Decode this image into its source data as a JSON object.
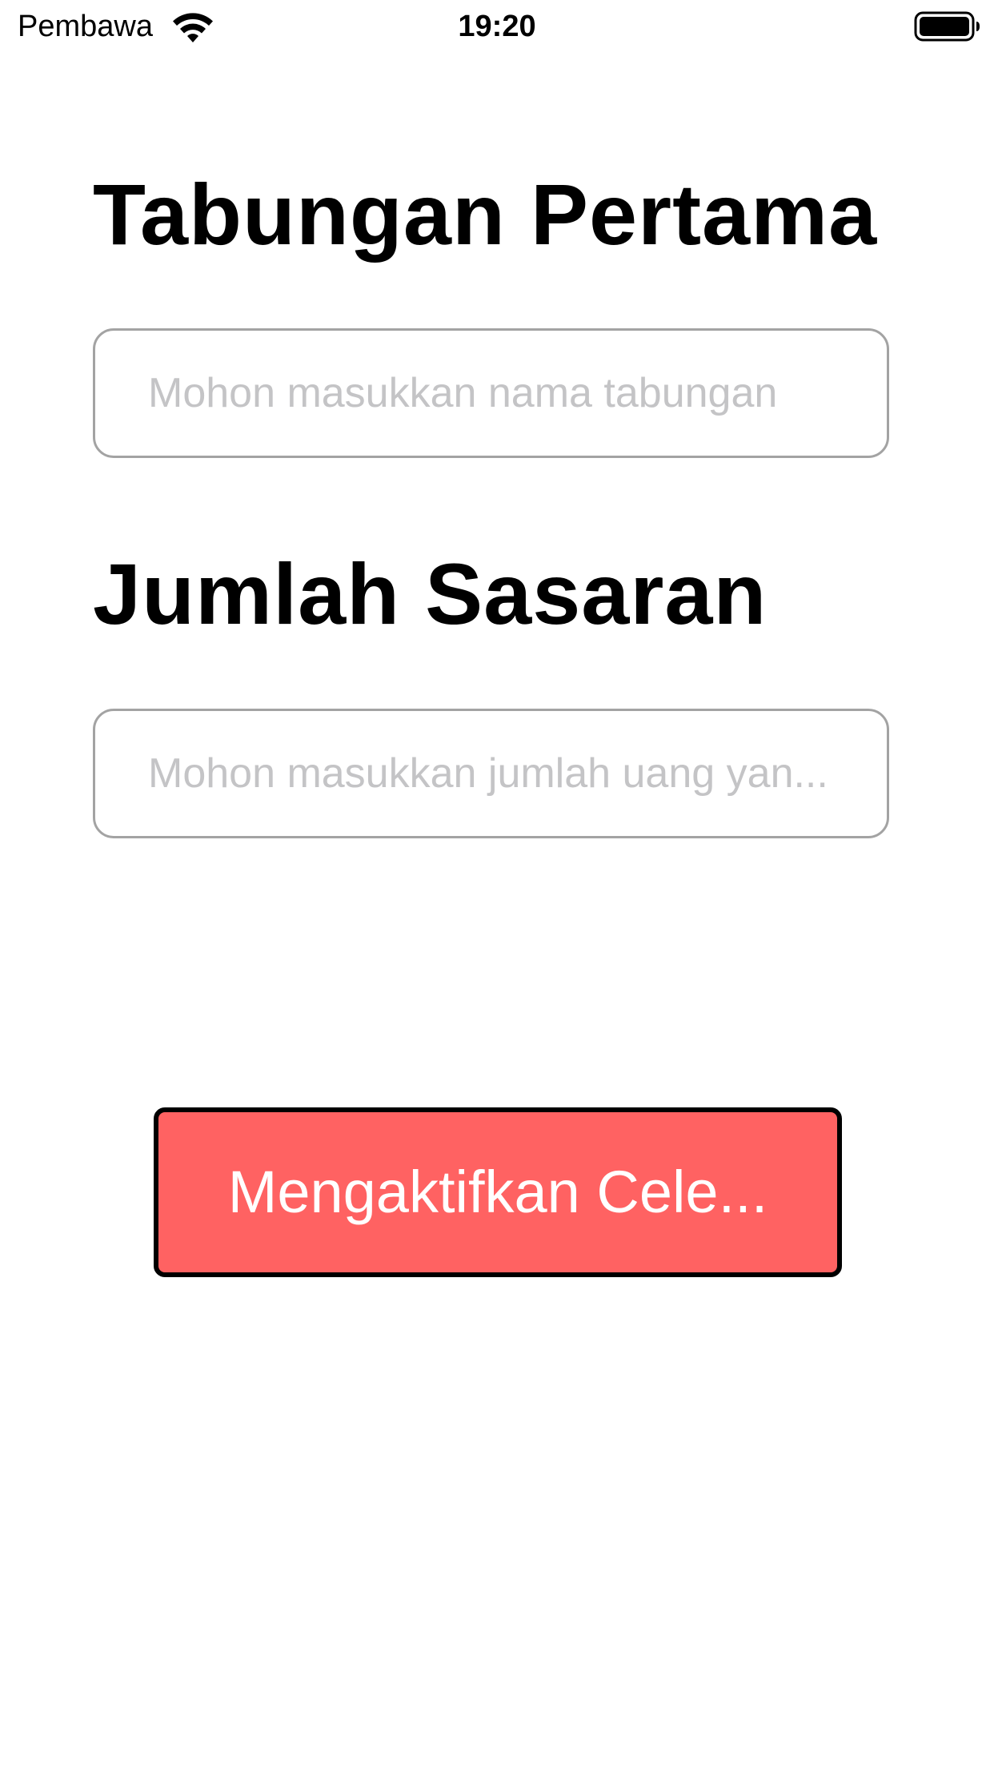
{
  "status_bar": {
    "carrier": "Pembawa",
    "time": "19:20",
    "wifi_icon": "wifi-icon",
    "battery_icon": "battery-full-icon"
  },
  "form": {
    "name_label": "Tabungan Pertama",
    "name_placeholder": "Mohon masukkan nama tabungan",
    "amount_label": "Jumlah Sasaran",
    "amount_placeholder": "Mohon masukkan jumlah uang yan..."
  },
  "actions": {
    "activate_label": "Mengaktifkan Cele...",
    "activate_color": "#ff6262"
  }
}
